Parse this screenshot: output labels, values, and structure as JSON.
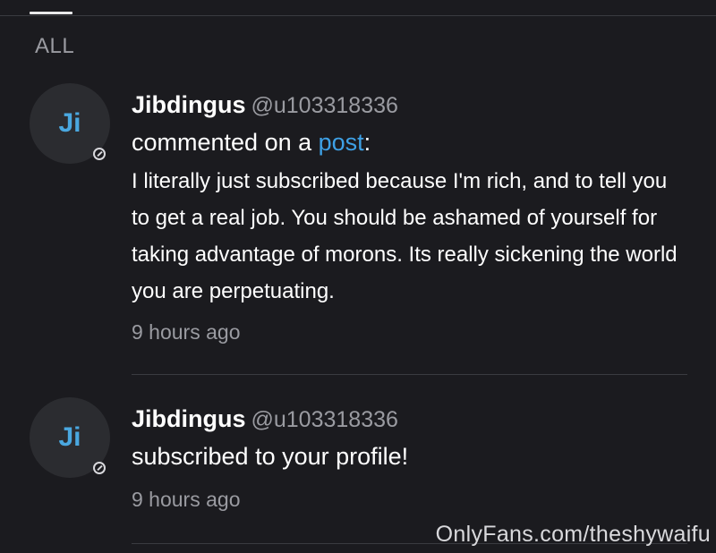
{
  "tabs": {
    "active_label": "ALL"
  },
  "notifications": [
    {
      "avatar_initials": "Ji",
      "name": "Jibdingus",
      "handle": "@u103318336",
      "action_prefix": "commented on a ",
      "action_link": "post",
      "action_suffix": ":",
      "comment": "I literally just subscribed because I'm rich, and to tell you to get a real job. You should be ashamed of yourself for taking advantage of morons. Its really sickening the world you are perpetuating.",
      "time": "9 hours ago"
    },
    {
      "avatar_initials": "Ji",
      "name": "Jibdingus",
      "handle": "@u103318336",
      "action_text": "subscribed to your profile!",
      "time": "9 hours ago"
    }
  ],
  "watermark": "OnlyFans.com/theshywaifu",
  "colors": {
    "background": "#1b1b1f",
    "link": "#3ea1e6",
    "avatar_initials": "#4aa8e0",
    "muted_text": "#9a9ba1"
  }
}
